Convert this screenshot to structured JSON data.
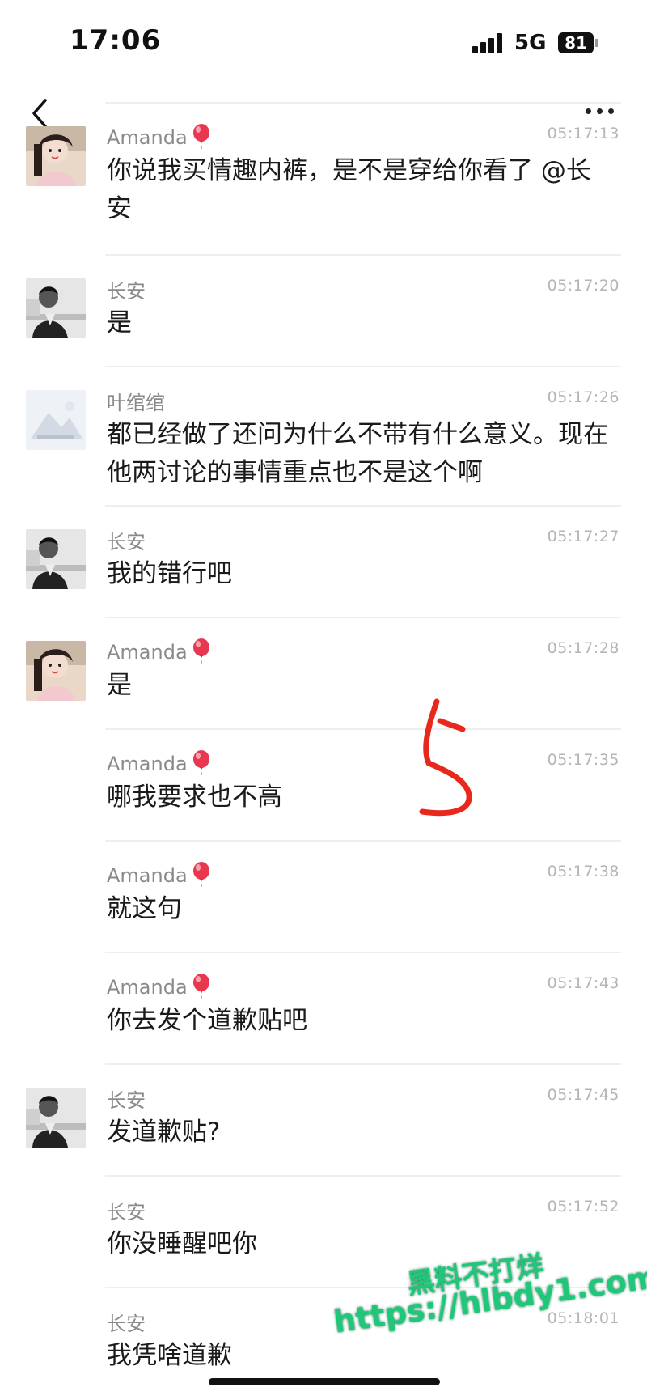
{
  "status_bar": {
    "time": "17:06",
    "network": "5G",
    "battery": "81"
  },
  "nav": {
    "back_icon": "chevron-left-icon",
    "more_icon": "ellipsis-icon"
  },
  "messages": [
    {
      "sender": "Amanda",
      "badge": "balloon-icon",
      "time": "05:17:13",
      "avatar": "amanda",
      "text": "你说我买情趣内裤，是不是穿给你看了 @长安"
    },
    {
      "sender": "长安",
      "time": "05:17:20",
      "avatar": "changan",
      "text": "是"
    },
    {
      "sender": "叶绾绾",
      "time": "05:17:26",
      "avatar": "yewanwan",
      "text": "都已经做了还问为什么不带有什么意义。现在他两讨论的事情重点也不是这个啊"
    },
    {
      "sender": "长安",
      "time": "05:17:27",
      "avatar": "changan",
      "text": "我的错行吧"
    },
    {
      "sender": "Amanda",
      "badge": "balloon-icon",
      "time": "05:17:28",
      "avatar": "amanda",
      "text": "是"
    },
    {
      "sender": "Amanda",
      "badge": "balloon-icon",
      "time": "05:17:35",
      "avatar": "",
      "text": "哪我要求也不高"
    },
    {
      "sender": "Amanda",
      "badge": "balloon-icon",
      "time": "05:17:38",
      "avatar": "",
      "text": "就这句"
    },
    {
      "sender": "Amanda",
      "badge": "balloon-icon",
      "time": "05:17:43",
      "avatar": "",
      "text": "你去发个道歉贴吧"
    },
    {
      "sender": "长安",
      "time": "05:17:45",
      "avatar": "changan",
      "text": "发道歉贴?"
    },
    {
      "sender": "长安",
      "time": "05:17:52",
      "avatar": "",
      "text": "你没睡醒吧你"
    },
    {
      "sender": "长安",
      "time": "05:18:01",
      "avatar": "",
      "text": "我凭啥道歉"
    }
  ],
  "annotation": {
    "handwritten_mark": "5"
  },
  "watermark": {
    "line1": "黑料不打烊",
    "line2": "https://hlbdy1.com"
  },
  "colors": {
    "sender": "#8a8a8a",
    "timestamp": "#b5b5b5",
    "separator": "#eeeeee",
    "annotation": "#e8281c",
    "watermark": "#1fc77a"
  }
}
